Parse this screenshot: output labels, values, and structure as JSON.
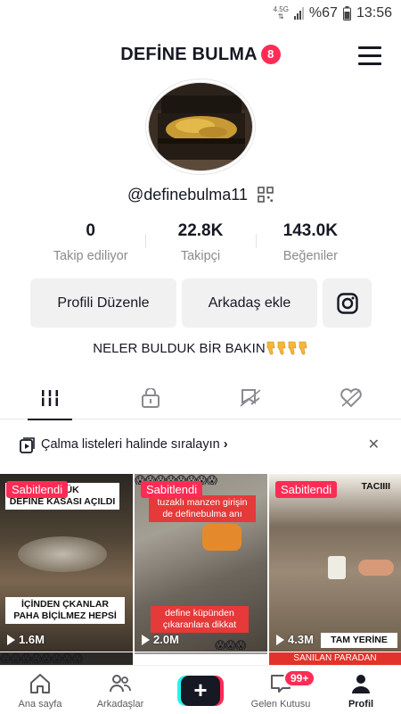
{
  "status_bar": {
    "network": "4.5G",
    "battery": "%67",
    "time": "13:56"
  },
  "header": {
    "title": "DEFİNE BULMA",
    "notification_count": "8"
  },
  "profile": {
    "handle": "@definebulma11",
    "stats": [
      {
        "value": "0",
        "label": "Takip ediliyor"
      },
      {
        "value": "22.8K",
        "label": "Takipçi"
      },
      {
        "value": "143.0K",
        "label": "Beğeniler"
      }
    ],
    "buttons": {
      "edit": "Profili Düzenle",
      "add_friend": "Arkadaş ekle"
    },
    "bio": "NELER BULDUK BİR BAKIN"
  },
  "tabs": [
    "videos-icon",
    "lock-icon",
    "saved-icon",
    "liked-icon"
  ],
  "playlist_banner": {
    "text": "Çalma listeleri halinde sıralayın"
  },
  "videos": [
    {
      "pinned": "Sabitlendi",
      "caption_top": "BÜYÜK\nDEFİNE KASASI AÇILDI",
      "caption_bottom": "İÇİNDEN ÇKANLAR\nPAHA BİÇİLMEZ HEPSİ",
      "views": "1.6M"
    },
    {
      "pinned": "Sabitlendi",
      "caption_top": "tuzaklı manzen girişin\nde definebulma anı",
      "caption_bottom": "define küpünden\nçıkaranlara dikkat",
      "views": "2.0M"
    },
    {
      "pinned": "Sabitlendi",
      "caption_top": "TACIIII",
      "caption_bottom": "TAM YERİNE",
      "views": "4.3M"
    }
  ],
  "row2_caption": "SANILAN PARADAN",
  "bottom_nav": [
    {
      "label": "Ana sayfa"
    },
    {
      "label": "Arkadaşlar"
    },
    {
      "label": ""
    },
    {
      "label": "Gelen Kutusu",
      "badge": "99+"
    },
    {
      "label": "Profil"
    }
  ],
  "colors": {
    "accent": "#fe2c55",
    "cyan": "#25f4ee",
    "text": "#161823",
    "muted": "#8a8b91"
  }
}
